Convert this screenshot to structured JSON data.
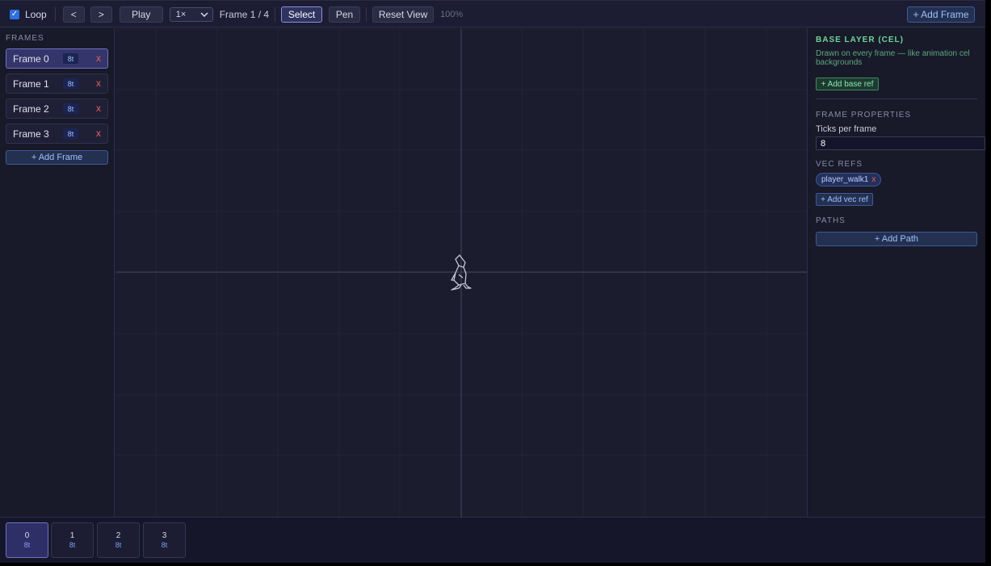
{
  "toolbar": {
    "loop_label": "Loop",
    "prev_label": "<",
    "next_label": ">",
    "play_label": "Play",
    "speed_value": "1×",
    "frame_counter": "Frame 1 / 4",
    "select_label": "Select",
    "pen_label": "Pen",
    "reset_view_label": "Reset View",
    "zoom_level": "100%",
    "add_frame_label": "+ Add Frame"
  },
  "frames_panel": {
    "title": "FRAMES",
    "items": [
      {
        "label": "Frame 0",
        "ticks": "8t",
        "delete": "x"
      },
      {
        "label": "Frame 1",
        "ticks": "8t",
        "delete": "x"
      },
      {
        "label": "Frame 2",
        "ticks": "8t",
        "delete": "x"
      },
      {
        "label": "Frame 3",
        "ticks": "8t",
        "delete": "x"
      }
    ],
    "add_label": "+ Add Frame"
  },
  "properties": {
    "base_layer_title": "BASE LAYER (CEL)",
    "base_layer_desc": "Drawn on every frame — like animation cel backgrounds",
    "add_base_ref_label": "+ Add base ref",
    "frame_properties_title": "FRAME PROPERTIES",
    "ticks_label": "Ticks per frame",
    "ticks_value": "8",
    "vec_refs_title": "VEC REFS",
    "vec_refs": [
      {
        "name": "player_walk1",
        "remove": "x"
      }
    ],
    "add_vec_ref_label": "+ Add vec ref",
    "paths_title": "PATHS",
    "add_path_label": "+ Add Path"
  },
  "timeline": {
    "cells": [
      {
        "num": "0",
        "ticks": "8t"
      },
      {
        "num": "1",
        "ticks": "8t"
      },
      {
        "num": "2",
        "ticks": "8t"
      },
      {
        "num": "3",
        "ticks": "8t"
      }
    ]
  },
  "colors": {
    "accent": "#2f6fe0",
    "selected_frame": "#34356a",
    "delete": "#e0605a",
    "base_layer": "#6fd79a"
  },
  "icons": {
    "loop_checkbox": "checkmark",
    "speed_dropdown": "chevron-down-icon",
    "canvas_sprite": "walking-figure-icon"
  }
}
